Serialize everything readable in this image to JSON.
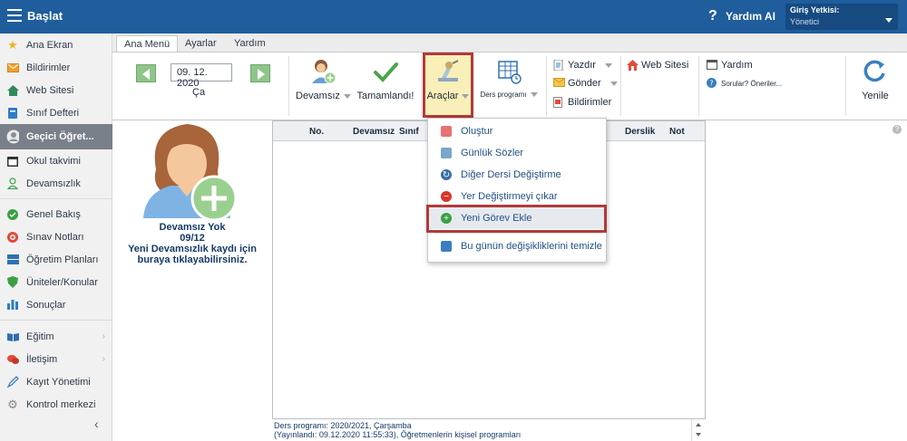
{
  "topbar": {
    "title": "Başlat",
    "help_label": "Yardım AI",
    "help_symbol": "?",
    "auth_label": "Giriş Yetkisi:",
    "auth_value": "Yönetici"
  },
  "sidebar": {
    "items": [
      {
        "label": "Ana Ekran",
        "icon": "star-icon"
      },
      {
        "label": "Bildirimler",
        "icon": "mail-icon"
      },
      {
        "label": "Web Sitesi",
        "icon": "home-icon"
      },
      {
        "label": "Sınıf Defteri",
        "icon": "notebook-icon"
      },
      {
        "label": "Geçici Öğret...",
        "icon": "person-icon"
      },
      {
        "label": "Okul takvimi",
        "icon": "calendar-icon"
      },
      {
        "label": "Devamsızlık",
        "icon": "user-outline-icon"
      },
      {
        "label": "Genel Bakış",
        "icon": "check-circle-icon"
      },
      {
        "label": "Sınav Notları",
        "icon": "target-icon"
      },
      {
        "label": "Öğretim Planları",
        "icon": "layers-icon"
      },
      {
        "label": "Üniteler/Konular",
        "icon": "shield-icon"
      },
      {
        "label": "Sonuçlar",
        "icon": "bar-chart-icon"
      },
      {
        "label": "Eğitim",
        "icon": "book-icon"
      },
      {
        "label": "İletişim",
        "icon": "chat-icon"
      },
      {
        "label": "Kayıt Yönetimi",
        "icon": "pen-icon"
      },
      {
        "label": "Kontrol merkezi",
        "icon": "gear-icon"
      }
    ]
  },
  "tabs": [
    "Ana Menü",
    "Ayarlar",
    "Yardım"
  ],
  "ribbon": {
    "date": "09. 12. 2020",
    "day": "Ça",
    "absent_label": "Devamsız",
    "completed_label": "Tamamlandı!",
    "tools_label": "Araçlar",
    "schedule_label": "Ders programı",
    "print_label": "Yazdır",
    "send_label": "Gönder",
    "notifications_label": "Bildirimler",
    "website_label": "Web Sitesi",
    "help_label": "Yardım",
    "questions_label": "Sorular? Öneriler...",
    "refresh_label": "Yenile"
  },
  "person": {
    "line1": "Devamsız Yok",
    "line2": "09/12",
    "line3": "Yeni Devamsızlık kaydı için",
    "line4": "buraya tıklayabilirsiniz."
  },
  "grid": {
    "columns": [
      "No.",
      "Devamsız",
      "Sınıf",
      "Derslik",
      "Not"
    ]
  },
  "footer": {
    "line1": "Ders programı: 2020/2021, Çarşamba",
    "line2": "(Yayınlandı: 09.12.2020 11:55:33), Öğretmenlerin kişisel programları"
  },
  "dropdown": {
    "items": [
      {
        "label": "Oluştur",
        "icon": "create-icon",
        "color": "#e57373"
      },
      {
        "label": "Günlük Sözler",
        "icon": "quote-icon",
        "color": "#7aa6c9"
      },
      {
        "label": "Diğer Dersi Değiştirme",
        "icon": "swap-icon",
        "color": "#3a6ea5"
      },
      {
        "label": "Yer Değiştirmeyi çıkar",
        "icon": "remove-icon",
        "color": "#d9352a"
      },
      {
        "label": "Yeni Görev Ekle",
        "icon": "add-icon",
        "color": "#3aa043"
      },
      {
        "label": "Bu günün değişikliklerini temizle",
        "icon": "clear-icon",
        "color": "#3a7fc1"
      }
    ]
  },
  "colors": {
    "topbar": "#1f5d9c",
    "highlight": "#b13a3a",
    "tools_bg": "#f9efb8"
  }
}
